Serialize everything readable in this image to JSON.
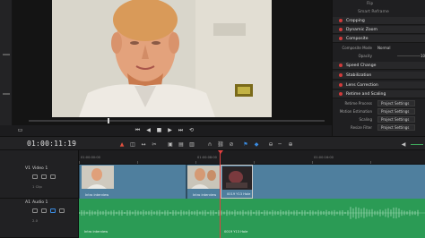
{
  "inspector": {
    "top_label": "Flip",
    "rows": [
      {
        "kind": "plain",
        "title": "Smart Reframe"
      },
      {
        "kind": "header",
        "title": "Cropping"
      },
      {
        "kind": "header",
        "title": "Dynamic Zoom"
      },
      {
        "kind": "header",
        "title": "Composite"
      },
      {
        "kind": "prop",
        "label": "Composite Mode",
        "value": "Normal"
      },
      {
        "kind": "prop",
        "label": "Opacity",
        "value": "100"
      },
      {
        "kind": "header",
        "title": "Speed Change"
      },
      {
        "kind": "header",
        "title": "Stabilization"
      },
      {
        "kind": "header",
        "title": "Lens Correction"
      },
      {
        "kind": "header",
        "title": "Retime and Scaling"
      },
      {
        "kind": "prop",
        "label": "Retime Process",
        "value": "Project Settings"
      },
      {
        "kind": "prop",
        "label": "Motion Estimation",
        "value": "Project Settings"
      },
      {
        "kind": "prop",
        "label": "Scaling",
        "value": "Project Settings"
      },
      {
        "kind": "prop",
        "label": "Resize Filter",
        "value": "Project Settings"
      }
    ]
  },
  "timeline": {
    "timecode": "01:00:11:19",
    "ruler": [
      "01:00:00:00",
      "01:00:08:00",
      "01:00:16:00"
    ],
    "tracks": {
      "video": {
        "id": "V1",
        "name": "Video 1",
        "count": "1 Clip"
      },
      "audio": {
        "id": "A1",
        "name": "Audio 1",
        "level": "2.0"
      }
    },
    "video_clips": [
      "Intro interview",
      "Intro interview",
      "0019 Y13 Hole"
    ],
    "audio_clips": [
      "Intro interview",
      "0019 Y13 Hole"
    ]
  },
  "colors": {
    "video_track": "#4f7f9e",
    "audio_track": "#2b9b55",
    "playhead": "#e04040",
    "accent": "#d23b3b"
  }
}
